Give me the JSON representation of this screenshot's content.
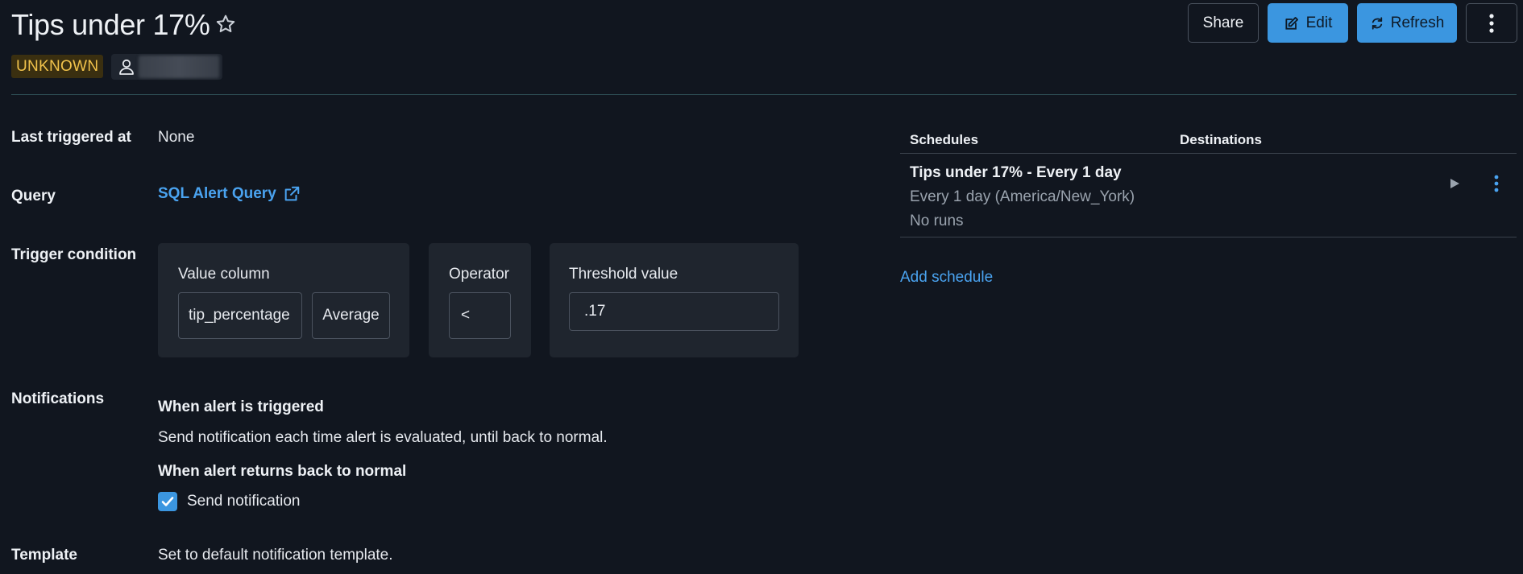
{
  "header": {
    "title": "Tips under 17%",
    "status": "UNKNOWN",
    "share_label": "Share",
    "edit_label": "Edit",
    "refresh_label": "Refresh"
  },
  "details": {
    "last_triggered_label": "Last triggered at",
    "last_triggered_value": "None",
    "query_label": "Query",
    "query_link": "SQL Alert Query",
    "trigger_label": "Trigger condition",
    "value_column_label": "Value column",
    "value_column": "tip_percentage",
    "aggregation": "Average",
    "operator_label": "Operator",
    "operator": "<",
    "threshold_label": "Threshold value",
    "threshold": ".17",
    "notifications_label": "Notifications",
    "when_triggered_heading": "When alert is triggered",
    "when_triggered_text": "Send notification each time alert is evaluated, until back to normal.",
    "back_to_normal_heading": "When alert returns back to normal",
    "send_notification_label": "Send notification",
    "send_notification_checked": true,
    "template_label": "Template",
    "template_value": "Set to default notification template."
  },
  "schedules": {
    "col_schedules": "Schedules",
    "col_destinations": "Destinations",
    "items": [
      {
        "name": "Tips under 17% - Every 1 day",
        "frequency": "Every 1 day (America/New_York)",
        "runs": "No runs"
      }
    ],
    "add_label": "Add schedule"
  },
  "colors": {
    "background": "#11161f",
    "accent": "#3b96e0",
    "link": "#4aa3f0",
    "status_warning": "#f0c24b"
  },
  "icons": [
    "star-icon",
    "user-icon",
    "edit-icon",
    "refresh-icon",
    "kebab-icon",
    "external-link-icon",
    "play-icon",
    "check-icon"
  ]
}
